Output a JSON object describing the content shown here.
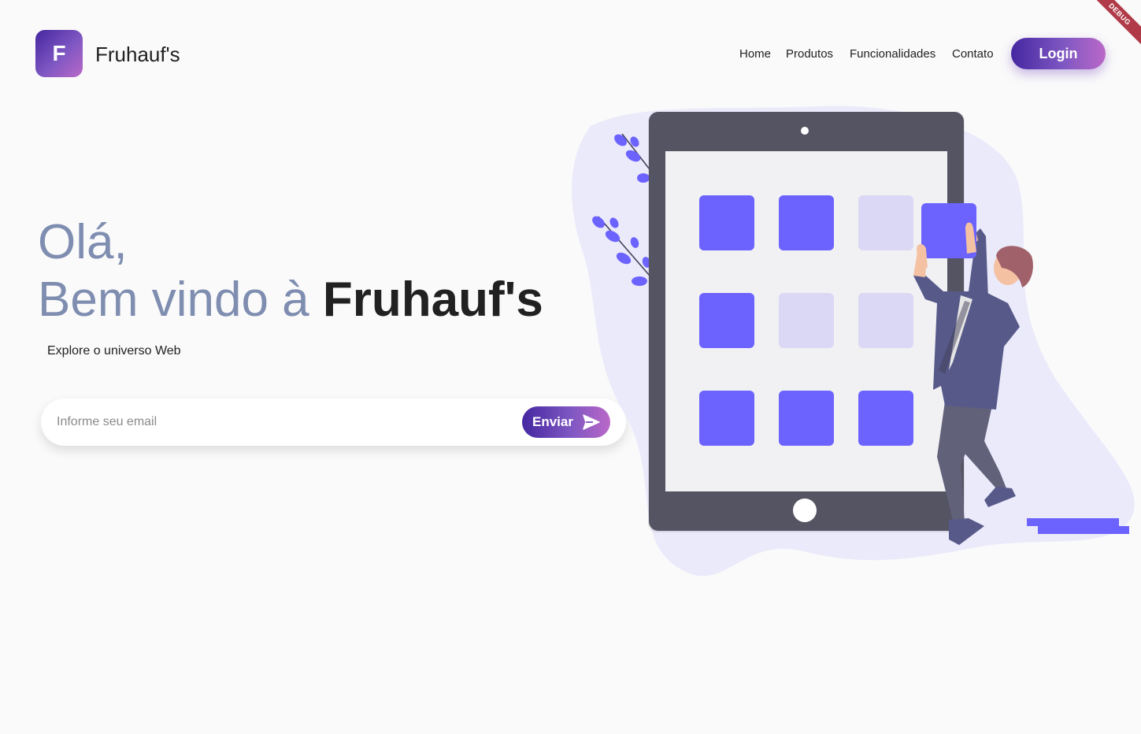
{
  "header": {
    "logo_letter": "F",
    "brand_name": "Fruhauf's",
    "nav": {
      "home": "Home",
      "produtos": "Produtos",
      "funcionalidades": "Funcionalidades",
      "contato": "Contato"
    },
    "login_label": "Login",
    "debug_label": "DEBUG"
  },
  "hero": {
    "greeting": "Olá,",
    "welcome_prefix": "Bem vindo à ",
    "welcome_brand": "Fruhauf's",
    "subtitle": "Explore o universo Web"
  },
  "subscribe": {
    "email_placeholder": "Informe seu email",
    "email_value": "",
    "send_label": "Enviar",
    "send_icon": "send-icon"
  },
  "colors": {
    "accent_dark": "#4527a0",
    "accent_light": "#ba68c8",
    "greeting_text": "#7e8db0",
    "illustration_purple": "#6c63ff"
  }
}
